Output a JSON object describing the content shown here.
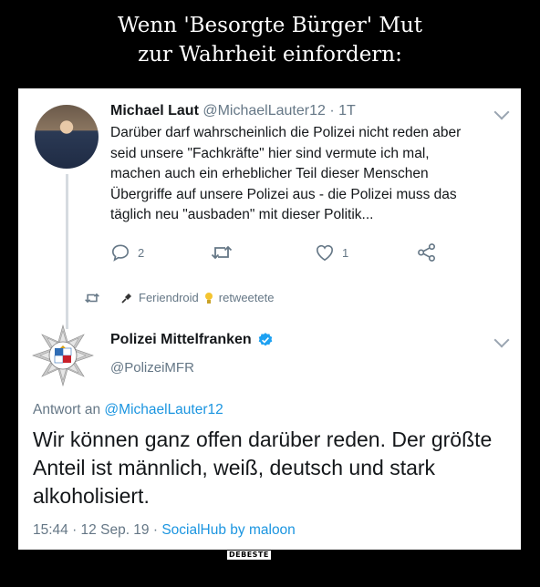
{
  "headline": {
    "line1": "Wenn 'Besorgte Bürger' Mut",
    "line2": "zur Wahrheit einfordern:"
  },
  "tweet1": {
    "author_name": "Michael Laut",
    "author_handle_time": "@MichaelLauter12 · 1T",
    "body": "Darüber darf wahrscheinlich die Polizei nicht reden aber\nseid unsere \"Fachkräfte\" hier sind vermute ich mal,\nmachen auch ein erheblicher Teil dieser Menschen\nÜbergriffe auf unsere Polizei aus    - die Polizei muss das\ntäglich neu \"ausbaden\" mit dieser Politik...",
    "reply_count": "2",
    "like_count": "1"
  },
  "retweet_bar": {
    "retweeter": "Feriendroid",
    "action": "retweetete"
  },
  "tweet2": {
    "author_name": "Polizei Mittelfranken",
    "author_handle": "@PolizeiMFR",
    "reply_prefix": "Antwort an",
    "reply_mention": "@MichaelLauter12",
    "body": "Wir können ganz offen darüber reden. Der größte Anteil ist männlich, weiß, deutsch und stark alkoholisiert.",
    "timestamp": "15:44 · 12 Sep. 19 · ",
    "source": "SocialHub by maloon"
  },
  "watermark": "DEBESTE",
  "colors": {
    "link": "#1b95e0",
    "muted": "#657786",
    "text": "#14171a",
    "verified": "#1da1f2"
  },
  "icons": [
    "reply-icon",
    "retweet-icon",
    "like-icon",
    "share-icon",
    "chevron-down-icon",
    "verified-icon",
    "plug-icon",
    "bulb-icon",
    "police-star-logo"
  ]
}
